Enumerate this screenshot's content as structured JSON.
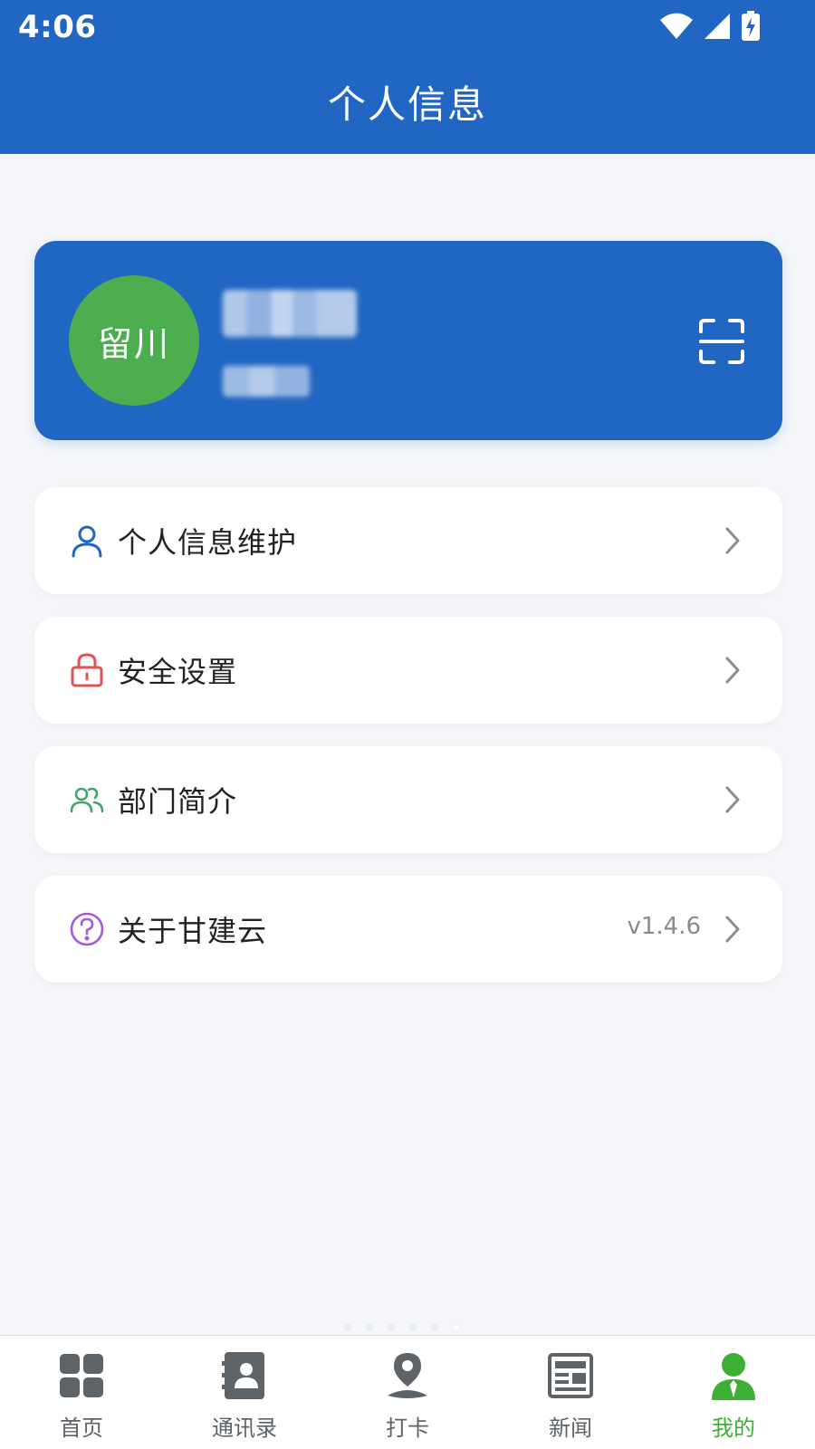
{
  "status_bar": {
    "time": "4:06"
  },
  "header": {
    "title": "个人信息"
  },
  "profile": {
    "avatar_text": "留川",
    "avatar_color": "#4cae4f",
    "card_color": "#2166c2"
  },
  "menu": {
    "items": [
      {
        "label": "个人信息维护",
        "icon": "user-icon",
        "icon_color": "#2166c2",
        "value": ""
      },
      {
        "label": "安全设置",
        "icon": "lock-icon",
        "icon_color": "#e05252",
        "value": ""
      },
      {
        "label": "部门简介",
        "icon": "group-icon",
        "icon_color": "#3fa66b",
        "value": ""
      },
      {
        "label": "关于甘建云",
        "icon": "question-icon",
        "icon_color": "#a35bd8",
        "value": "v1.4.6"
      }
    ]
  },
  "tabbar": {
    "items": [
      {
        "label": "首页",
        "icon": "grid-icon",
        "active": false
      },
      {
        "label": "通讯录",
        "icon": "contacts-icon",
        "active": false
      },
      {
        "label": "打卡",
        "icon": "location-pin-icon",
        "active": false
      },
      {
        "label": "新闻",
        "icon": "newspaper-icon",
        "active": false
      },
      {
        "label": "我的",
        "icon": "profile-icon",
        "active": true
      }
    ],
    "active_color": "#3cb035",
    "inactive_color": "#5e6368"
  }
}
